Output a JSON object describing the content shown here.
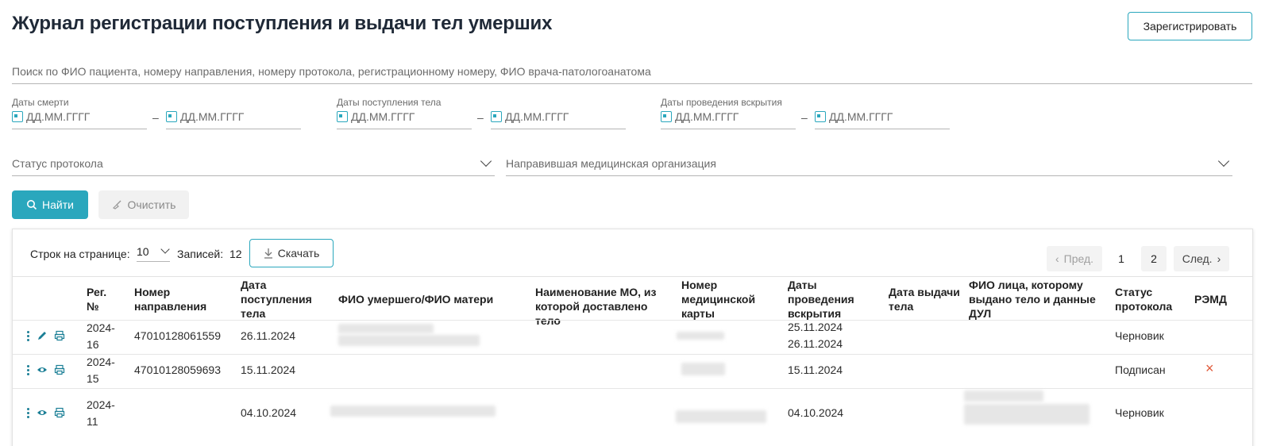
{
  "header": {
    "title": "Журнал регистрации поступления и выдачи тел умерших",
    "register_label": "Зарегистрировать"
  },
  "search": {
    "placeholder": "Поиск по ФИО пациента, номеру направления, номеру протокола, регистрационному номеру, ФИО врача-патологоанатома"
  },
  "filters": {
    "death_dates_label": "Даты смерти",
    "admission_dates_label": "Даты поступления тела",
    "autopsy_dates_label": "Даты проведения вскрытия",
    "date_placeholder": "ДД.ММ.ГГГГ",
    "dash": "–",
    "protocol_status_label": "Статус протокола",
    "referring_org_label": "Направившая медицинская организация",
    "find_label": "Найти",
    "clear_label": "Очистить"
  },
  "table_toolbar": {
    "rows_per_page_label": "Строк на странице:",
    "rows_per_page_value": "10",
    "records_label": "Записей:",
    "records_count": "12",
    "download_label": "Скачать"
  },
  "pagination": {
    "prev": "Пред.",
    "pages": [
      "1",
      "2"
    ],
    "next": "След.",
    "current": "1"
  },
  "columns": [
    "Рег. №",
    "Номер направления",
    "Дата поступления тела",
    "ФИО умершего/ФИО матери",
    "Наименование МО, из которой доставлено тело",
    "Номер медицинской карты",
    "Даты проведения вскрытия",
    "Дата выдачи тела",
    "ФИО лица, которому выдано тело и данные ДУЛ",
    "Статус протокола",
    "РЭМД"
  ],
  "rows": [
    {
      "reg": "2024-16",
      "referral": "47010128061559",
      "admission": "26.11.2024",
      "autopsy1": "25.11.2024",
      "autopsy2": "26.11.2024",
      "status": "Черновик",
      "remd": "",
      "view_icon": "pencil-icon"
    },
    {
      "reg": "2024-15",
      "referral": "47010128059693",
      "admission": "15.11.2024",
      "autopsy1": "15.11.2024",
      "autopsy2": "",
      "status": "Подписан",
      "remd": "×",
      "view_icon": "eye-icon"
    },
    {
      "reg": "2024-11",
      "referral": "",
      "admission": "04.10.2024",
      "autopsy1": "04.10.2024",
      "autopsy2": "",
      "status": "Черновик",
      "remd": "",
      "view_icon": "eye-icon"
    }
  ],
  "colors": {
    "accent": "#2aa7bd",
    "danger": "#e05a3a"
  }
}
